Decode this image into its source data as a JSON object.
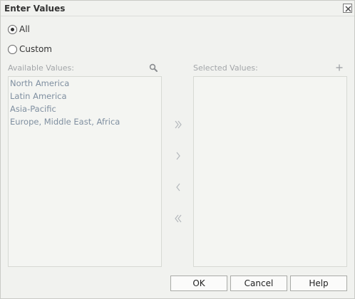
{
  "dialog": {
    "title": "Enter Values"
  },
  "options": {
    "all_label": "All",
    "custom_label": "Custom",
    "selected": "all"
  },
  "available": {
    "label": "Available Values:",
    "items": [
      {
        "label": "North America"
      },
      {
        "label": "Latin America"
      },
      {
        "label": "Asia-Pacific"
      },
      {
        "label": "Europe, Middle East, Africa"
      }
    ]
  },
  "selected_values": {
    "label": "Selected Values:",
    "items": []
  },
  "icons": {
    "close": "close-icon",
    "search": "search-icon",
    "add": "plus-icon",
    "move_all_right": "double-chevron-right-icon",
    "move_right": "chevron-right-icon",
    "move_left": "chevron-left-icon",
    "move_all_left": "double-chevron-left-icon"
  },
  "buttons": {
    "ok": "OK",
    "cancel": "Cancel",
    "help": "Help"
  },
  "colors": {
    "background": "#f1f2ef",
    "list_text": "#7f8fa0",
    "label_text": "#a3a6a9",
    "arrow": "#b4b8bc"
  }
}
